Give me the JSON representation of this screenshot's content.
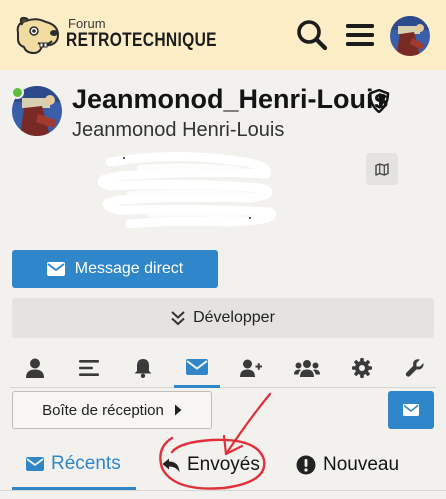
{
  "header": {
    "logo_small": "Forum",
    "logo_big": "RETROTECHNIQUE",
    "icons": [
      "dog-logo-icon",
      "search-icon",
      "menu-icon",
      "user-avatar"
    ]
  },
  "profile": {
    "username": "Jeanmonod_Henri-Louis",
    "fullname": "Jeanmonod Henri-Louis",
    "online": true,
    "status_color": "#5bbf3e"
  },
  "actions": {
    "message_label": "Message direct",
    "expand_label": "Développer"
  },
  "tabs": [
    {
      "icon": "user-icon",
      "active": false
    },
    {
      "icon": "list-icon",
      "active": false
    },
    {
      "icon": "bell-icon",
      "active": false
    },
    {
      "icon": "envelope-icon",
      "active": true
    },
    {
      "icon": "user-plus-icon",
      "active": false
    },
    {
      "icon": "users-icon",
      "active": false
    },
    {
      "icon": "gear-icon",
      "active": false
    },
    {
      "icon": "wrench-icon",
      "active": false
    }
  ],
  "inbox": {
    "dropdown_label": "Boîte de réception"
  },
  "subtabs": [
    {
      "label": "Récents",
      "icon": "envelope-icon",
      "active": true
    },
    {
      "label": "Envoyés",
      "icon": "reply-icon",
      "active": false
    },
    {
      "label": "Nouveau",
      "icon": "exclamation-circle-icon",
      "active": false
    }
  ],
  "colors": {
    "accent": "#2f86c8",
    "header_bg": "#fbedc6",
    "page_bg": "#f2f1ee",
    "annotation": "#e0303a"
  }
}
